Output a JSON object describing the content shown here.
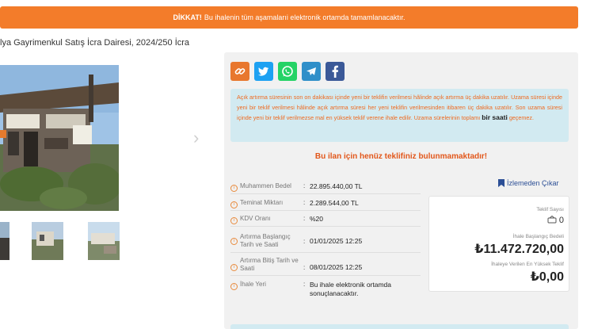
{
  "banner": {
    "strong": "DİKKAT!",
    "text": "Bu ihalenin tüm aşamalarıi elektronik ortamda tamamlanacaktır."
  },
  "breadcrumb": "lya Gayrimenkul Satış İcra Dairesi, 2024/250 İcra",
  "share": {
    "icons": [
      "link-icon",
      "twitter-icon",
      "whatsapp-icon",
      "telegram-icon",
      "facebook-icon"
    ],
    "colors": [
      "#e8772e",
      "#1da1f2",
      "#25d366",
      "#2f8fc9",
      "#3b5998"
    ]
  },
  "notice": {
    "text": "Açık artırma süresinin son on dakikası içinde yeni bir teklifin verilmesi hâlinde açık artırma üç dakika uzatılır. Uzama süresi içinde yeni bir teklif verilmesi hâlinde açık artırma süresi her yeni teklifin verilmesinden itibaren üç dakika uzatılır. Son uzama süresi içinde yeni bir teklif verilmezse mal en yüksek teklif verene ihale edilir. Uzama sürelerinin toplamı",
    "bold": "bir saati",
    "tail": "geçemez."
  },
  "no_bids": "Bu ilan için henüz teklifiniz bulunmamaktadır!",
  "unwatch_label": "İzlemeden Çıkar",
  "info": {
    "muhammen": {
      "label": "Muhammen Bedel",
      "value": "22.895.440,00 TL"
    },
    "teminat": {
      "label": "Teminat Miktarı",
      "value": "2.289.544,00 TL"
    },
    "kdv": {
      "label": "KDV Oranı",
      "value": "%20"
    },
    "baslangic": {
      "label": "Artırma Başlangıç Tarih ve Saati",
      "value": "01/01/2025 12:25"
    },
    "bitis": {
      "label": "Artırma Bitiş Tarih ve Saati",
      "value": "08/01/2025 12:25"
    },
    "ihale_yeri": {
      "label": "İhale Yeri",
      "value": "Bu ihale elektronik ortamda sonuçlanacaktır."
    }
  },
  "bid_box": {
    "teklif_sayisi_label": "Teklif Sayısı",
    "teklif_sayisi": "0",
    "baslangic_label": "İhale Başlangıç Bedeli",
    "baslangic_value": "₺11.472.720,00",
    "en_yuksek_label": "İhaleye Verilen En Yüksek Teklif",
    "en_yuksek_value": "₺0,00"
  },
  "gallery": {
    "next": "›"
  }
}
